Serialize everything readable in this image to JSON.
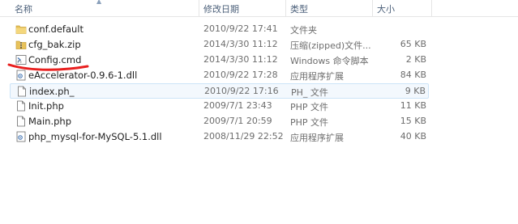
{
  "columns": {
    "name": "名称",
    "date": "修改日期",
    "type": "类型",
    "size": "大小"
  },
  "files": [
    {
      "name": "conf.default",
      "date": "2010/9/22 17:41",
      "type": "文件夹",
      "size": "",
      "icon": "folder-icon"
    },
    {
      "name": "cfg_bak.zip",
      "date": "2014/3/30 11:12",
      "type": "压缩(zipped)文件...",
      "size": "65 KB",
      "icon": "zip-folder-icon"
    },
    {
      "name": "Config.cmd",
      "date": "2014/3/30 11:12",
      "type": "Windows 命令脚本",
      "size": "2 KB",
      "icon": "cmd-script-icon"
    },
    {
      "name": "eAccelerator-0.9.6-1.dll",
      "date": "2010/9/22 17:28",
      "type": "应用程序扩展",
      "size": "84 KB",
      "icon": "dll-icon"
    },
    {
      "name": "index.ph_",
      "date": "2010/9/22 17:16",
      "type": "PH_ 文件",
      "size": "9 KB",
      "icon": "file-icon"
    },
    {
      "name": "Init.php",
      "date": "2009/7/1 23:43",
      "type": "PHP 文件",
      "size": "11 KB",
      "icon": "file-icon"
    },
    {
      "name": "Main.php",
      "date": "2009/7/1 20:59",
      "type": "PHP 文件",
      "size": "15 KB",
      "icon": "file-icon"
    },
    {
      "name": "php_mysql-for-MySQL-5.1.dll",
      "date": "2008/11/29 22:52",
      "type": "应用程序扩展",
      "size": "40 KB",
      "icon": "dll-icon"
    }
  ],
  "colors": {
    "selection_bg": "#f3f8fd",
    "selection_border": "#cce4f7",
    "annotation_red": "#e8201f",
    "folder_yellow": "#e8c25a"
  }
}
